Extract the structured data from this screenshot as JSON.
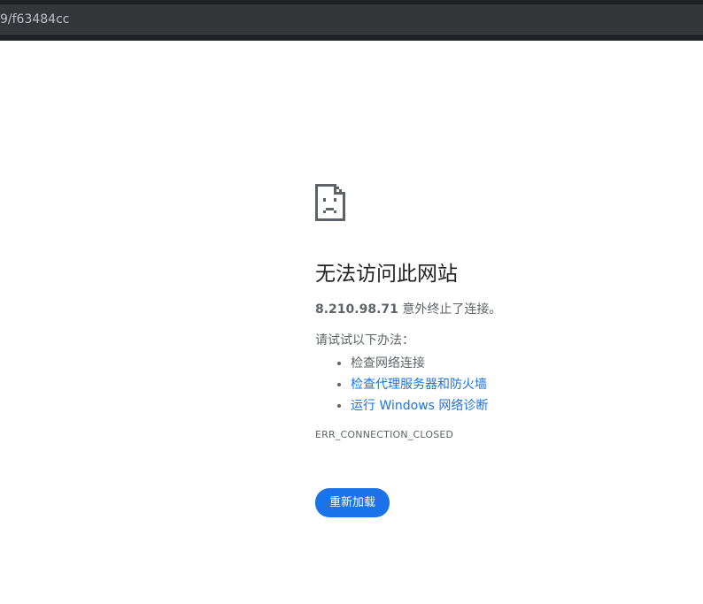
{
  "address_bar": {
    "url_text": "9/f63484cc"
  },
  "error_page": {
    "icon": "sad-page-icon",
    "title": "无法访问此网站",
    "host": "8.210.98.71",
    "summary_text": " 意外终止了连接。",
    "suggest_intro": "请试试以下办法：",
    "suggestions": [
      {
        "label": "检查网络连接",
        "is_link": false
      },
      {
        "label": "检查代理服务器和防火墙",
        "is_link": true
      },
      {
        "label": "运行 Windows 网络诊断",
        "is_link": true
      }
    ],
    "error_code": "ERR_CONNECTION_CLOSED",
    "reload_label": "重新加载"
  },
  "colors": {
    "link": "#1a73e8",
    "button_bg": "#1a73e8",
    "text": "#5f6368",
    "title": "#202124"
  }
}
